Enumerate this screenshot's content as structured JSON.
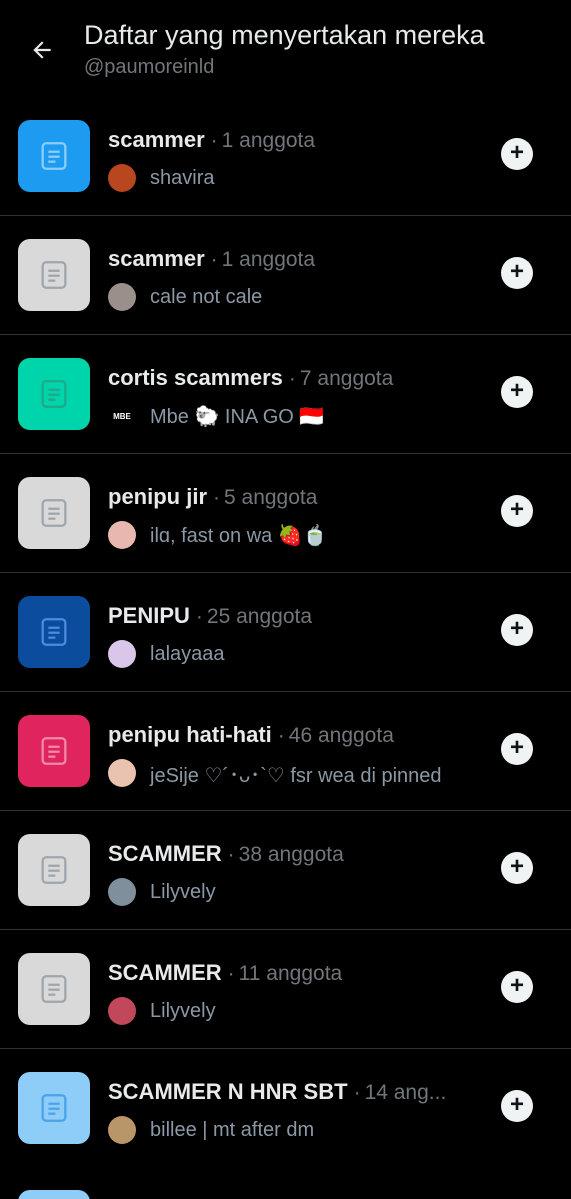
{
  "header": {
    "title": "Daftar yang menyertakan mereka",
    "handle": "@paumoreinld"
  },
  "colors": {
    "background": "#000000",
    "divider": "#2f3336",
    "muted_text": "#71767b"
  },
  "lists": [
    {
      "name": "scammer",
      "separator": "·",
      "members": "1 anggota",
      "owner": "shavira",
      "thumb_color": "#1d9bf0",
      "doc_color": "#8ecdf8",
      "avatar_color": "#b8461f",
      "avatar_label": ""
    },
    {
      "name": "scammer",
      "separator": "·",
      "members": "1 anggota",
      "owner": "cale not cale",
      "thumb_color": "#d9d9d9",
      "doc_color": "#9ea6ad",
      "avatar_color": "#9a8f8a",
      "avatar_label": ""
    },
    {
      "name": "cortis scammers",
      "separator": "·",
      "members": "7 anggota",
      "owner": "Mbe 🐑 INA GO 🇮🇩",
      "thumb_color": "#00d4aa",
      "doc_color": "#1fa88a",
      "avatar_color": "#000000",
      "avatar_label": "MBE"
    },
    {
      "name": "penipu jir",
      "separator": "·",
      "members": "5 anggota",
      "owner": "ilɑ, fast on wa 🍓🍵",
      "thumb_color": "#d9d9d9",
      "doc_color": "#9ea6ad",
      "avatar_color": "#e8b8b0",
      "avatar_label": ""
    },
    {
      "name": "PENIPU",
      "separator": "·",
      "members": "25 anggota",
      "owner": "lalayaaa",
      "thumb_color": "#0b4c9c",
      "doc_color": "#4d8be0",
      "avatar_color": "#d9c6e8",
      "avatar_label": ""
    },
    {
      "name": "penipu hati-hati",
      "separator": "·",
      "members": "46 anggota",
      "owner": "jeSije ♡´･ᴗ･`♡ fsr wea di pinned",
      "thumb_color": "#e0245e",
      "doc_color": "#f08aa8",
      "avatar_color": "#e9c2b0",
      "avatar_label": ""
    },
    {
      "name": "SCAMMER",
      "separator": "·",
      "members": "38 anggota",
      "owner": "Lilyvely",
      "thumb_color": "#d9d9d9",
      "doc_color": "#9ea6ad",
      "avatar_color": "#7f8f9c",
      "avatar_label": ""
    },
    {
      "name": "SCAMMER",
      "separator": "·",
      "members": "11 anggota",
      "owner": "Lilyvely",
      "thumb_color": "#d9d9d9",
      "doc_color": "#9ea6ad",
      "avatar_color": "#c0485a",
      "avatar_label": ""
    },
    {
      "name": "SCAMMER N HNR SBT",
      "separator": "·",
      "members": "14 ang...",
      "owner": "billee | mt after dm",
      "thumb_color": "#8ecdf8",
      "doc_color": "#4aa3e6",
      "avatar_color": "#b8966a",
      "avatar_label": ""
    }
  ],
  "icons": {
    "back": "arrow-left-icon",
    "list": "list-document-icon",
    "add": "plus-icon"
  }
}
